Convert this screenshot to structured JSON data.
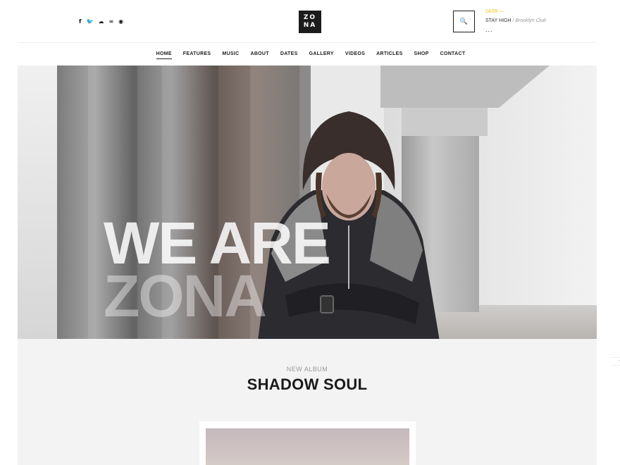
{
  "header": {
    "social": [
      {
        "name": "facebook-icon",
        "glyph": "f"
      },
      {
        "name": "twitter-icon",
        "glyph": "🐦"
      },
      {
        "name": "soundcloud-icon",
        "glyph": "☁"
      },
      {
        "name": "lastfm-icon",
        "glyph": "∞"
      },
      {
        "name": "spotify-icon",
        "glyph": "◉"
      }
    ],
    "logo_line1": "ZO",
    "logo_line2": "NA",
    "search_icon": "🔍",
    "event": {
      "date": "24/05 —",
      "title": "STAY HIGH",
      "venue": "/ Brooklyn Club",
      "more": "..."
    }
  },
  "nav": {
    "items": [
      {
        "label": "HOME",
        "active": true
      },
      {
        "label": "FEATURES"
      },
      {
        "label": "MUSIC"
      },
      {
        "label": "ABOUT"
      },
      {
        "label": "DATES"
      },
      {
        "label": "GALLERY"
      },
      {
        "label": "VIDEOS"
      },
      {
        "label": "ARTICLES"
      },
      {
        "label": "SHOP"
      },
      {
        "label": "CONTACT"
      }
    ]
  },
  "hero": {
    "line1": "WE ARE",
    "line2": "ZONA"
  },
  "album": {
    "kicker": "NEW ALBUM",
    "title": "SHADOW SOUL"
  },
  "side": {
    "glyph": "·"
  },
  "colors": {
    "accent": "#f1c40f",
    "dark": "#1c1c1c"
  }
}
